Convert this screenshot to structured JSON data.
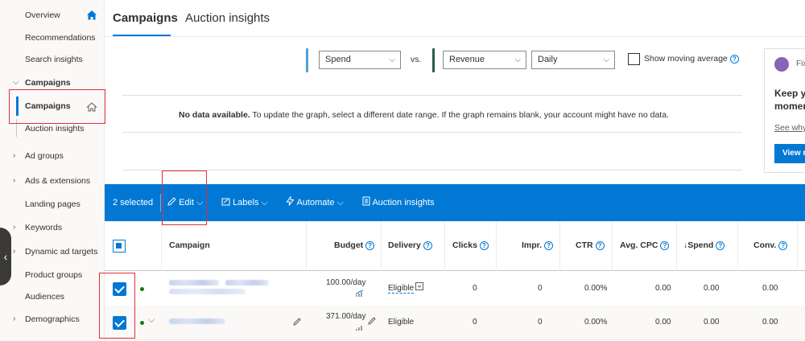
{
  "sidebar": {
    "items": [
      {
        "label": "Overview"
      },
      {
        "label": "Recommendations"
      },
      {
        "label": "Search insights"
      },
      {
        "label": "Campaigns"
      },
      {
        "label": "Campaigns"
      },
      {
        "label": "Auction insights"
      },
      {
        "label": "Ad groups"
      },
      {
        "label": "Ads & extensions"
      },
      {
        "label": "Landing pages"
      },
      {
        "label": "Keywords"
      },
      {
        "label": "Dynamic ad targets"
      },
      {
        "label": "Product groups"
      },
      {
        "label": "Audiences"
      },
      {
        "label": "Demographics"
      }
    ],
    "collapse_glyph": "‹"
  },
  "tabs": [
    {
      "label": "Campaigns",
      "active": true
    },
    {
      "label": "Auction insights",
      "active": false
    }
  ],
  "chart": {
    "metric1": "Spend",
    "vs": "vs.",
    "metric2": "Revenue",
    "granularity": "Daily",
    "moving_average": "Show moving average",
    "no_data_bold": "No data available.",
    "no_data_text": " To update the graph, select a different date range. If the graph remains blank, your account might have no data.",
    "metric1_color": "#4f9fd6",
    "metric2_color": "#2d5b4a"
  },
  "card": {
    "fix_label": "Fix",
    "title_line1": "Keep y",
    "title_line2": "momen",
    "link": "See why",
    "button": "View r"
  },
  "toolbar": {
    "selected": "2 selected",
    "edit": "Edit",
    "labels": "Labels",
    "automate": "Automate",
    "auction": "Auction insights"
  },
  "table": {
    "headers": {
      "campaign": "Campaign",
      "budget": "Budget",
      "delivery": "Delivery",
      "clicks": "Clicks",
      "impr": "Impr.",
      "ctr": "CTR",
      "avg_cpc": "Avg. CPC",
      "spend": "↓Spend",
      "conv": "Conv."
    },
    "rows": [
      {
        "budget": "100.00/day",
        "delivery": "Eligible",
        "clicks": "0",
        "impr": "0",
        "ctr": "0.00%",
        "avg_cpc": "0.00",
        "spend": "0.00",
        "conv": "0.00"
      },
      {
        "budget": "371.00/day",
        "delivery": "Eligible",
        "clicks": "0",
        "impr": "0",
        "ctr": "0.00%",
        "avg_cpc": "0.00",
        "spend": "0.00",
        "conv": "0.00"
      }
    ]
  }
}
